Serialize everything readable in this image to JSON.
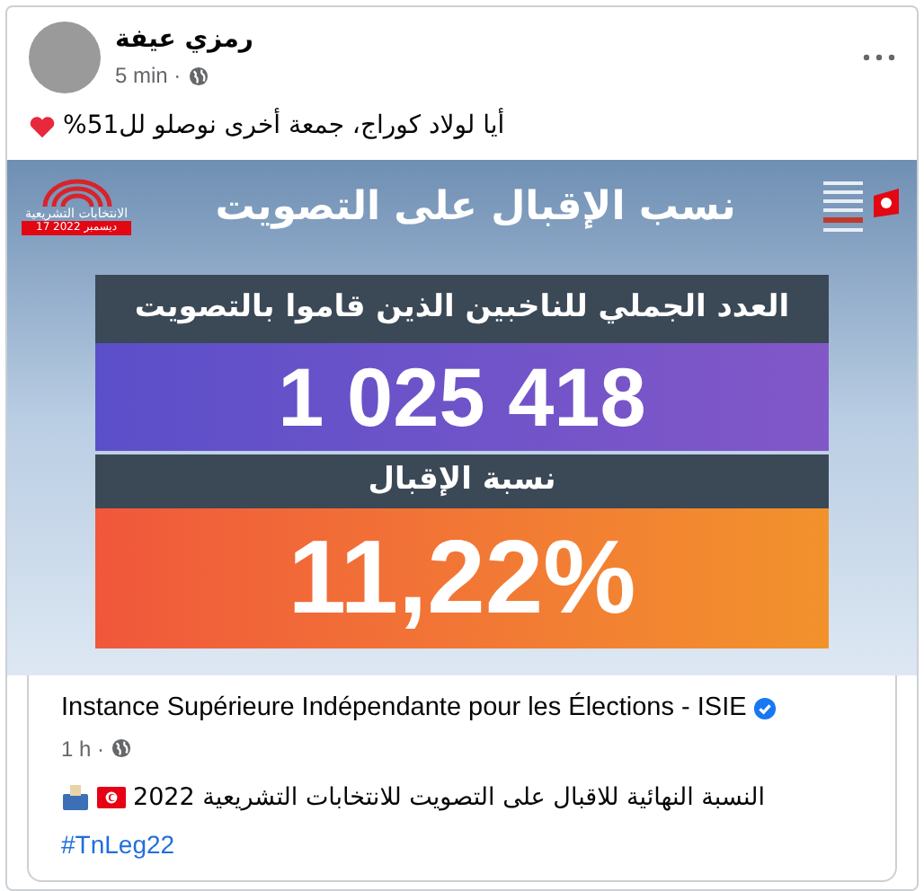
{
  "post": {
    "author": "رمزي عيفة",
    "time": "5 min ·",
    "text": "أيا لولاد كوراج، جمعة أخرى نوصلو لل51%"
  },
  "graphic": {
    "title": "نسب الإقبال على التصويت",
    "badge_title": "الانتخابات التشريعية",
    "badge_date": "17 ديسمبر 2022",
    "total_label": "العدد الجملي للناخبين الذين قاموا بالتصويت",
    "total_value": "1 025 418",
    "rate_label": "نسبة الإقبال",
    "rate_value": "11,22%"
  },
  "shared": {
    "author": "Instance Supérieure Indépendante pour les Élections - ISIE",
    "verified": true,
    "time": "1 h ·",
    "text": "النسبة النهائية للاقبال على التصويت للانتخابات التشريعية 2022",
    "hashtag": "#TnLeg22"
  }
}
